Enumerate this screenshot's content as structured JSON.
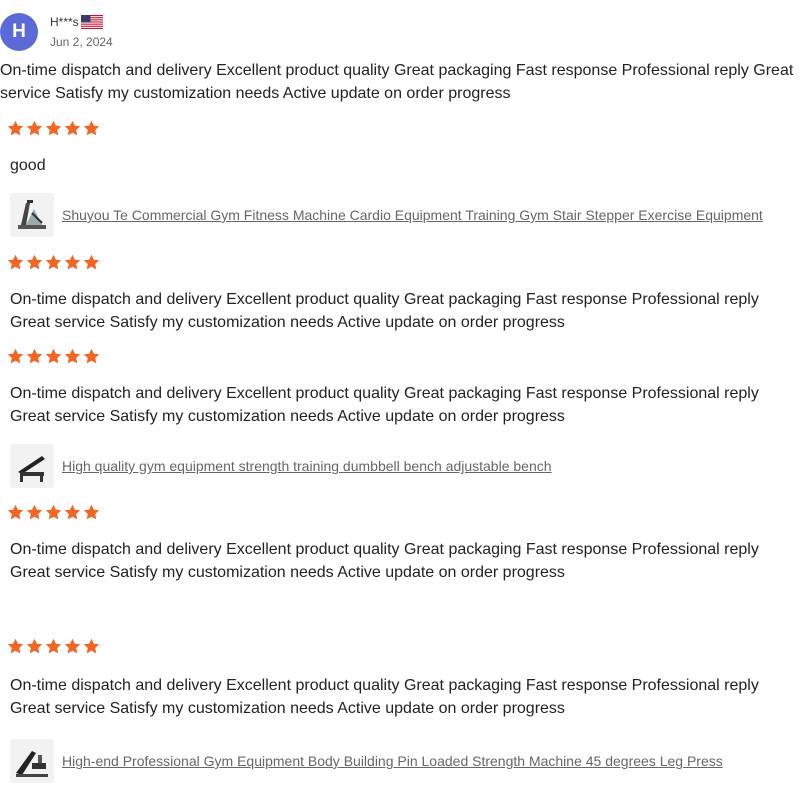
{
  "reviewer": {
    "initial": "H",
    "name": "H***s",
    "flag": "us-flag-icon",
    "date": "Jun 2, 2024"
  },
  "colors": {
    "avatar": "#5b6ad6",
    "star": "#f26522",
    "link": "#666666"
  },
  "main_review": {
    "text": "On-time dispatch and delivery Excellent product quality Great packaging Fast response Professional reply Great service Satisfy my customization needs Active update on order progress",
    "rating": 5
  },
  "reviews": [
    {
      "rating": 5,
      "text": "good",
      "product": {
        "icon": "stair-stepper-machine-icon",
        "title": "Shuyou Te Commercial Gym Fitness Machine Cardio Equipment Training Gym Stair Stepper Exercise Equipment"
      }
    },
    {
      "rating": 5,
      "text": "On-time dispatch and delivery Excellent product quality Great packaging Fast response Professional reply Great service Satisfy my customization needs Active update on order progress"
    },
    {
      "rating": 5,
      "text": "On-time dispatch and delivery Excellent product quality Great packaging Fast response Professional reply Great service Satisfy my customization needs Active update on order progress",
      "product": {
        "icon": "adjustable-bench-icon",
        "title": "High quality gym equipment strength training dumbbell bench adjustable bench"
      }
    },
    {
      "rating": 5,
      "text": "On-time dispatch and delivery Excellent product quality Great packaging Fast response Professional reply Great service Satisfy my customization needs Active update on order progress"
    },
    {
      "rating": 5,
      "text": "On-time dispatch and delivery Excellent product quality Great packaging Fast response Professional reply Great service Satisfy my customization needs Active update on order progress",
      "product": {
        "icon": "leg-press-machine-icon",
        "title": "High-end Professional Gym Equipment Body Building Pin Loaded Strength Machine 45 degrees Leg Press"
      }
    }
  ]
}
